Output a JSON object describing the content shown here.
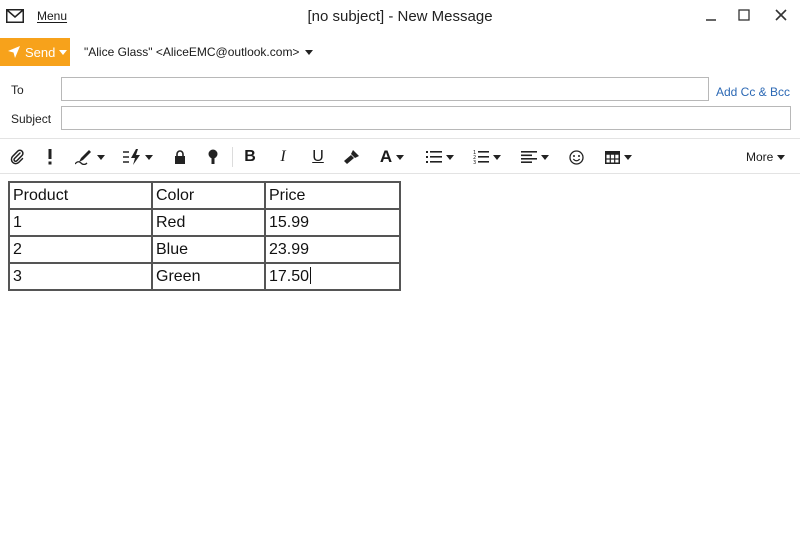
{
  "window": {
    "title": "[no subject] - New Message",
    "menu_label": "Menu"
  },
  "compose": {
    "send_label": "Send",
    "from": "\"Alice Glass\" <AliceEMC@outlook.com>",
    "to_label": "To",
    "to_value": "",
    "subject_label": "Subject",
    "subject_value": "",
    "add_cc_bcc": "Add Cc & Bcc",
    "accent_color": "#f7a21b",
    "link_color": "#2b68b4"
  },
  "toolbar": {
    "icons": [
      "attach-icon",
      "importance-icon",
      "signature-icon",
      "quick-actions-icon",
      "encrypt-icon",
      "sensitivity-icon",
      "bold-icon",
      "italic-icon",
      "underline-icon",
      "format-painter-icon",
      "font-color-icon",
      "bullets-icon",
      "numbering-icon",
      "align-icon",
      "emoji-icon",
      "table-icon"
    ],
    "bold": "B",
    "italic": "I",
    "underline": "U",
    "font": "A",
    "more_label": "More"
  },
  "body": {
    "table": {
      "headers": [
        "Product",
        "Color",
        "Price"
      ],
      "rows": [
        [
          "1",
          "Red",
          "15.99"
        ],
        [
          "2",
          "Blue",
          "23.99"
        ],
        [
          "3",
          "Green",
          "17.50"
        ]
      ]
    }
  }
}
